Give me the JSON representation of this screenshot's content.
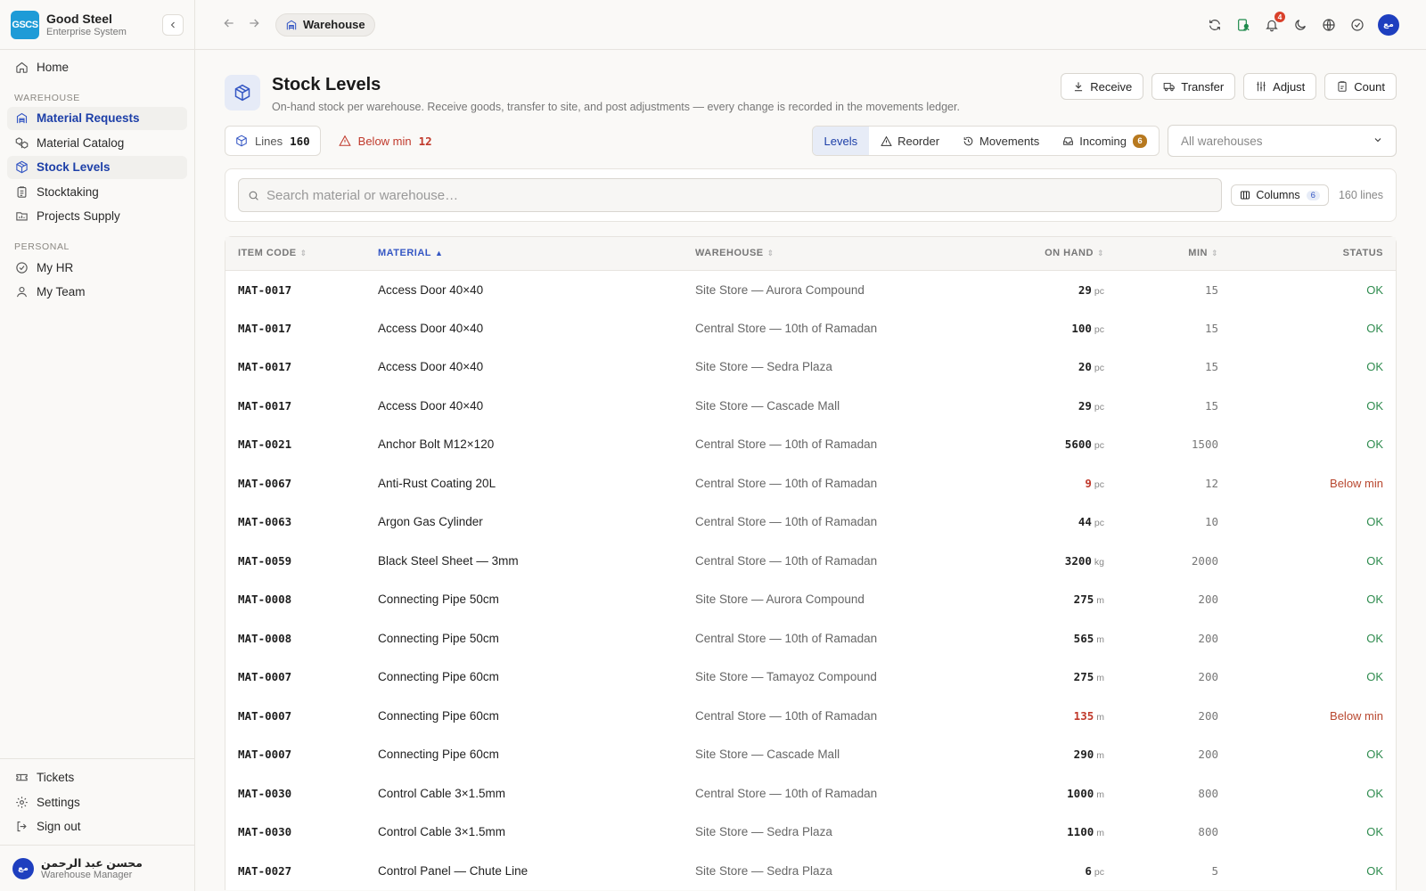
{
  "brand": {
    "logo": "GSCS",
    "name": "Good Steel",
    "subtitle": "Enterprise System"
  },
  "sidebar": {
    "home": "Home",
    "warehouse_section": "WAREHOUSE",
    "warehouse_items": [
      "Material Requests",
      "Material Catalog",
      "Stock Levels",
      "Stocktaking",
      "Projects Supply"
    ],
    "personal_section": "PERSONAL",
    "personal_items": [
      "My HR",
      "My Team"
    ],
    "bottom_items": [
      "Tickets",
      "Settings",
      "Sign out"
    ],
    "user": {
      "name": "محسن عبد الرحمن",
      "role": "Warehouse Manager",
      "initials": "مع"
    }
  },
  "topbar": {
    "breadcrumb": "Warehouse",
    "notifications": "4"
  },
  "page": {
    "title": "Stock Levels",
    "subtitle": "On-hand stock per warehouse. Receive goods, transfer to site, and post adjustments — every change is recorded in the movements ledger.",
    "actions": [
      "Receive",
      "Transfer",
      "Adjust",
      "Count"
    ]
  },
  "summary": {
    "lines_label": "Lines",
    "lines_value": "160",
    "below_label": "Below min",
    "below_value": "12"
  },
  "tabs": {
    "levels": "Levels",
    "reorder": "Reorder",
    "movements": "Movements",
    "incoming": "Incoming",
    "incoming_count": "6"
  },
  "warehouse_filter": {
    "selected": "All warehouses"
  },
  "search": {
    "placeholder": "Search material or warehouse…",
    "columns_label": "Columns",
    "columns_count": "6",
    "lines_text": "160 lines"
  },
  "table": {
    "headers": {
      "code": "ITEM CODE",
      "material": "MATERIAL",
      "warehouse": "WAREHOUSE",
      "on_hand": "ON HAND",
      "min": "MIN",
      "status": "STATUS"
    },
    "rows": [
      {
        "code": "MAT-0017",
        "material": "Access Door 40×40",
        "warehouse": "Site Store — Aurora Compound",
        "qty": "29",
        "unit": "pc",
        "min": "15",
        "status": "OK",
        "low": false
      },
      {
        "code": "MAT-0017",
        "material": "Access Door 40×40",
        "warehouse": "Central Store — 10th of Ramadan",
        "qty": "100",
        "unit": "pc",
        "min": "15",
        "status": "OK",
        "low": false
      },
      {
        "code": "MAT-0017",
        "material": "Access Door 40×40",
        "warehouse": "Site Store — Sedra Plaza",
        "qty": "20",
        "unit": "pc",
        "min": "15",
        "status": "OK",
        "low": false
      },
      {
        "code": "MAT-0017",
        "material": "Access Door 40×40",
        "warehouse": "Site Store — Cascade Mall",
        "qty": "29",
        "unit": "pc",
        "min": "15",
        "status": "OK",
        "low": false
      },
      {
        "code": "MAT-0021",
        "material": "Anchor Bolt M12×120",
        "warehouse": "Central Store — 10th of Ramadan",
        "qty": "5600",
        "unit": "pc",
        "min": "1500",
        "status": "OK",
        "low": false
      },
      {
        "code": "MAT-0067",
        "material": "Anti-Rust Coating 20L",
        "warehouse": "Central Store — 10th of Ramadan",
        "qty": "9",
        "unit": "pc",
        "min": "12",
        "status": "Below min",
        "low": true
      },
      {
        "code": "MAT-0063",
        "material": "Argon Gas Cylinder",
        "warehouse": "Central Store — 10th of Ramadan",
        "qty": "44",
        "unit": "pc",
        "min": "10",
        "status": "OK",
        "low": false
      },
      {
        "code": "MAT-0059",
        "material": "Black Steel Sheet — 3mm",
        "warehouse": "Central Store — 10th of Ramadan",
        "qty": "3200",
        "unit": "kg",
        "min": "2000",
        "status": "OK",
        "low": false
      },
      {
        "code": "MAT-0008",
        "material": "Connecting Pipe 50cm",
        "warehouse": "Site Store — Aurora Compound",
        "qty": "275",
        "unit": "m",
        "min": "200",
        "status": "OK",
        "low": false
      },
      {
        "code": "MAT-0008",
        "material": "Connecting Pipe 50cm",
        "warehouse": "Central Store — 10th of Ramadan",
        "qty": "565",
        "unit": "m",
        "min": "200",
        "status": "OK",
        "low": false
      },
      {
        "code": "MAT-0007",
        "material": "Connecting Pipe 60cm",
        "warehouse": "Site Store — Tamayoz Compound",
        "qty": "275",
        "unit": "m",
        "min": "200",
        "status": "OK",
        "low": false
      },
      {
        "code": "MAT-0007",
        "material": "Connecting Pipe 60cm",
        "warehouse": "Central Store — 10th of Ramadan",
        "qty": "135",
        "unit": "m",
        "min": "200",
        "status": "Below min",
        "low": true
      },
      {
        "code": "MAT-0007",
        "material": "Connecting Pipe 60cm",
        "warehouse": "Site Store — Cascade Mall",
        "qty": "290",
        "unit": "m",
        "min": "200",
        "status": "OK",
        "low": false
      },
      {
        "code": "MAT-0030",
        "material": "Control Cable 3×1.5mm",
        "warehouse": "Central Store — 10th of Ramadan",
        "qty": "1000",
        "unit": "m",
        "min": "800",
        "status": "OK",
        "low": false
      },
      {
        "code": "MAT-0030",
        "material": "Control Cable 3×1.5mm",
        "warehouse": "Site Store — Sedra Plaza",
        "qty": "1100",
        "unit": "m",
        "min": "800",
        "status": "OK",
        "low": false
      },
      {
        "code": "MAT-0027",
        "material": "Control Panel — Chute Line",
        "warehouse": "Site Store — Sedra Plaza",
        "qty": "6",
        "unit": "pc",
        "min": "5",
        "status": "OK",
        "low": false
      }
    ]
  },
  "colors": {
    "accent": "#3557c4",
    "ok": "#2e8b4e",
    "low": "#c0392b",
    "brand": "#1e9bd7"
  }
}
